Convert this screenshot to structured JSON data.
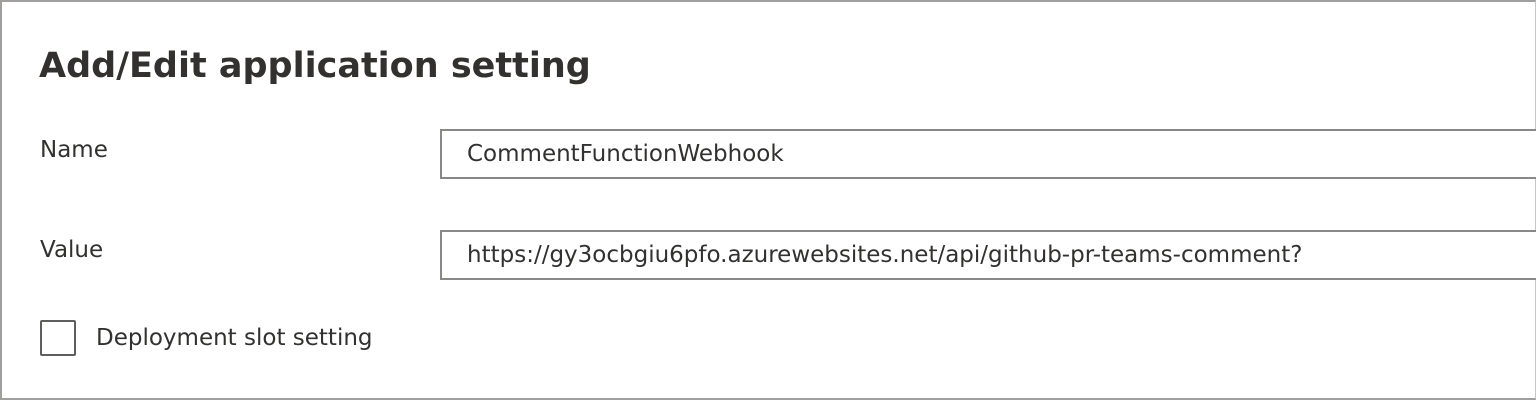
{
  "dialog": {
    "title": "Add/Edit application setting"
  },
  "fields": {
    "name": {
      "label": "Name",
      "value": "CommentFunctionWebhook"
    },
    "value": {
      "label": "Value",
      "value": "https://gy3ocbgiu6pfo.azurewebsites.net/api/github-pr-teams-comment?"
    }
  },
  "deployment_slot_setting": {
    "label": "Deployment slot setting",
    "checked": false
  },
  "colors": {
    "text": "#323130",
    "input_border": "#8a8886",
    "panel_border": "#a19f9d",
    "checkbox_border": "#605e5c",
    "background": "#ffffff"
  }
}
